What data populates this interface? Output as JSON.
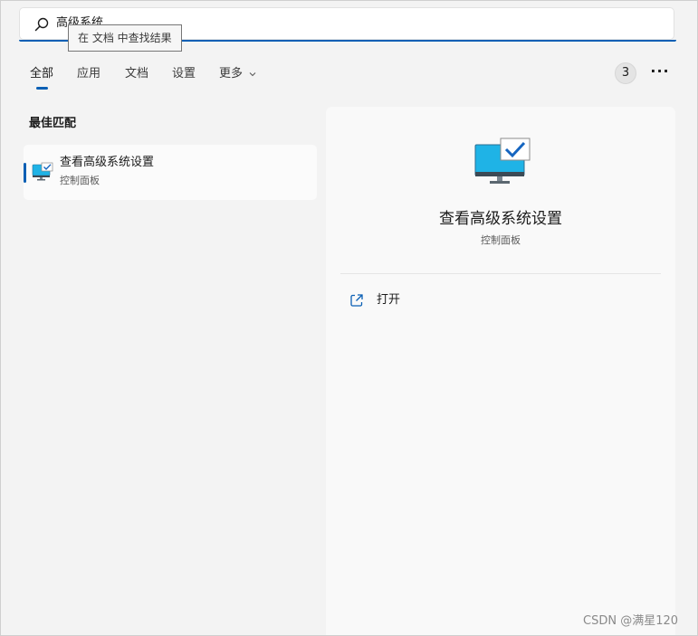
{
  "search": {
    "query": "高级系统",
    "tooltip": "在 文档 中查找结果"
  },
  "tabs": [
    {
      "label": "全部",
      "active": true
    },
    {
      "label": "应用"
    },
    {
      "label": "文档"
    },
    {
      "label": "设置"
    },
    {
      "label": "更多"
    }
  ],
  "header": {
    "badge_count": "3",
    "more_label": "···"
  },
  "best_match": {
    "section_title": "最佳匹配",
    "item": {
      "title": "查看高级系统设置",
      "subtitle": "控制面板",
      "icon": "monitor-check-icon"
    }
  },
  "detail": {
    "title": "查看高级系统设置",
    "subtitle": "控制面板",
    "icon": "monitor-check-icon",
    "actions": [
      {
        "label": "打开",
        "icon": "open-external-icon"
      }
    ]
  },
  "watermark": "CSDN @满星120",
  "colors": {
    "accent": "#0a5fb4",
    "monitor_screen": "#1fb3e6",
    "check": "#1565c0"
  }
}
